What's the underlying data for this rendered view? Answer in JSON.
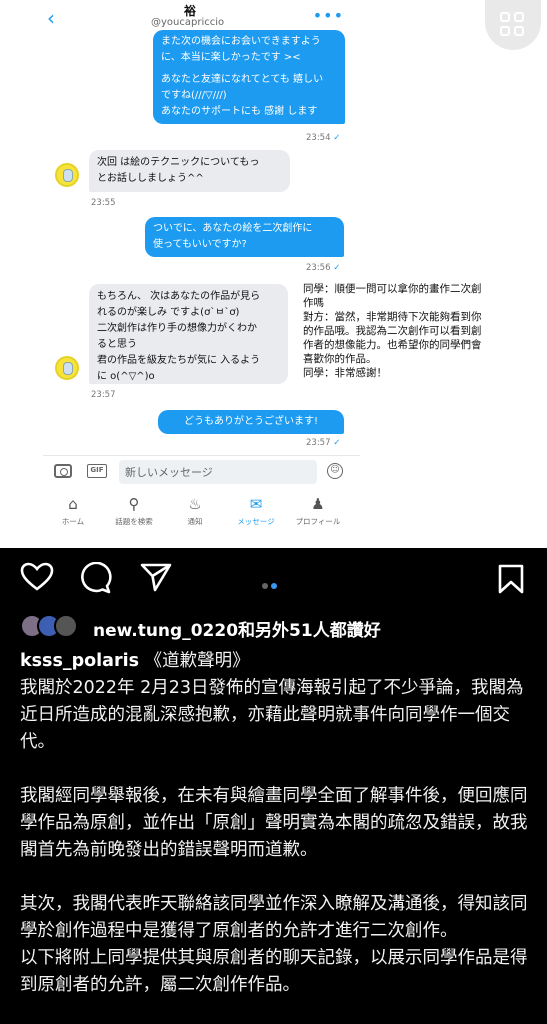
{
  "dm": {
    "contact_name": "裕",
    "contact_handle": "@youcapriccio",
    "messages": [
      {
        "from": "me",
        "lines": [
          "また次の機会にお会いできますよう",
          "に、本当に楽しかったです ><",
          "",
          "あなたと友達になれてとても 嬉しい",
          "ですね(///▽///)",
          "あなたのサポートにも 感謝 します"
        ],
        "time": "23:54"
      },
      {
        "from": "them",
        "lines": [
          "次回 は絵のテクニックについてもっ",
          "とお話ししましょう^^"
        ],
        "time": "23:55"
      },
      {
        "from": "me",
        "lines": [
          "ついでに、あなたの絵を二次創作に",
          "使ってもいいですか?"
        ],
        "time": "23:56"
      },
      {
        "from": "them",
        "lines": [
          "もちろん、 次はあなたの作品が見ら",
          "れるのが楽しみ ですよ(ơ`ㅂ`ơ)",
          "二次創作は作り手の想像力がくわか",
          "ると思う",
          "君の作品を級友たちが気に 入るよう",
          "に o(^▽^)o"
        ],
        "time": "23:57"
      },
      {
        "from": "me",
        "lines": [
          "どうもありがとうございます!"
        ],
        "time": "23:57"
      }
    ],
    "compose_placeholder": "新しいメッセージ",
    "gif_label": "GIF",
    "tabs": [
      {
        "label": "ホーム",
        "icon": "home-icon"
      },
      {
        "label": "話題を検索",
        "icon": "search-icon"
      },
      {
        "label": "通知",
        "icon": "bell-icon"
      },
      {
        "label": "メッセージ",
        "icon": "mail-icon",
        "active": true
      },
      {
        "label": "プロフィール",
        "icon": "profile-icon"
      }
    ],
    "translation_note": [
      "同學：順便一問可以拿你的畫作二次創",
      "作嗎",
      "對方：當然，非常期待下次能夠看到你",
      "的作品哦。我認為二次創作可以看到創",
      "作者的想像能力。也希望你的同學們會",
      "喜歡你的作品。",
      "同學：非常感謝！"
    ],
    "accent_color": "#1d9bf0"
  },
  "instagram": {
    "liked_by_user": "new.tung_0220",
    "liked_by_rest": "和另外51人都讚好",
    "author": "ksss_polaris",
    "caption_title": " 《道歉聲明》",
    "paragraphs": [
      "我閣於2022年 2月23日發佈的宣傳海報引起了不少爭論，我閣為近日所造成的混亂深感抱歉，亦藉此聲明就事件向同學作一個交代。",
      "",
      "我閣經同學舉報後，在未有與繪畫同學全面了解事件後，便回應同學作品為原創，並作出「原創」聲明實為本閣的疏忽及錯誤，故我閣首先為前晚發出的錯誤聲明而道歉。",
      "",
      "其次，我閣代表昨天聯絡該同學並作深入瞭解及溝通後，得知該同學於創作過程中是獲得了原創者的允許才進行二次創作。",
      "以下將附上同學提供其與原創者的聊天記錄，以展示同學作品是得到原創者的允許，屬二次創作作品。"
    ],
    "dot_color_active": "#3897f0"
  }
}
